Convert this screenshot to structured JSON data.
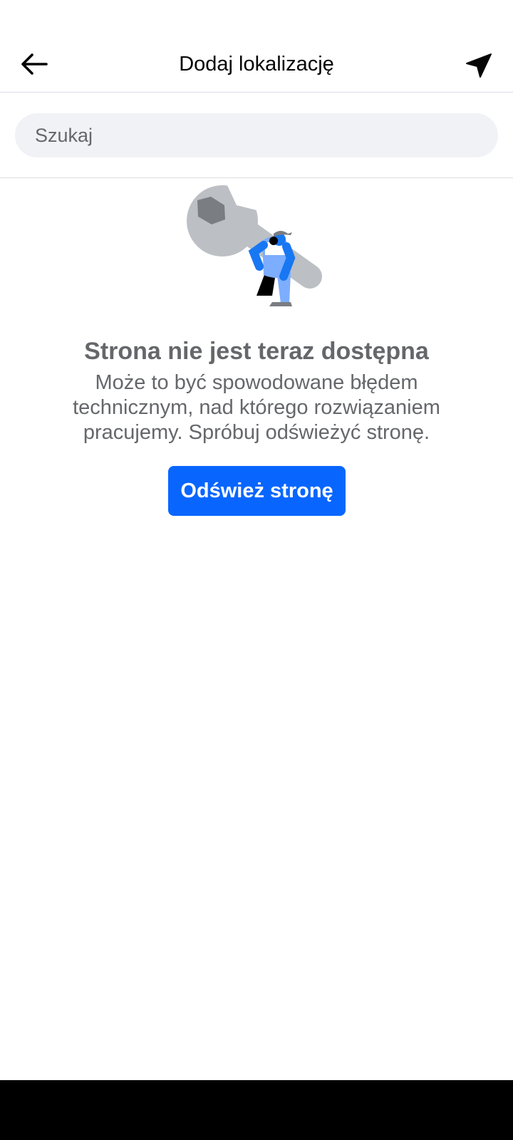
{
  "header": {
    "title": "Dodaj lokalizację",
    "back_icon": "arrow-left-icon",
    "location_icon": "navigation-arrow-icon"
  },
  "search": {
    "placeholder": "Szukaj",
    "value": ""
  },
  "error": {
    "illustration": "wrench-worker-illustration",
    "title": "Strona nie jest teraz dostępna",
    "message": "Może to być spowodowane błędem technicznym, nad którego rozwiązaniem pracujemy. Spróbuj odświeżyć stronę.",
    "refresh_label": "Odśwież stronę"
  },
  "colors": {
    "accent": "#0866ff",
    "secondary_text": "#65676b",
    "search_background": "#f0f2f5",
    "divider": "#dadde1"
  }
}
